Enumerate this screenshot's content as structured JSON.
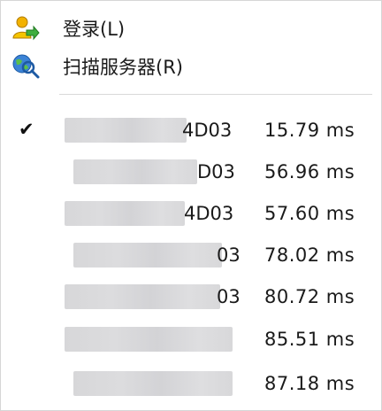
{
  "menu": {
    "items": [
      {
        "label": "登录(L)",
        "icon": "login-user-icon"
      },
      {
        "label": "扫描服务器(R)",
        "icon": "scan-globe-icon"
      }
    ],
    "servers": [
      {
        "checked": true,
        "check": "✔",
        "name_visible": "4D03",
        "ping": "15.79 ms"
      },
      {
        "checked": false,
        "check": "",
        "name_visible": "D03",
        "ping": "56.96 ms"
      },
      {
        "checked": false,
        "check": "",
        "name_visible": "4D03",
        "ping": "57.60 ms"
      },
      {
        "checked": false,
        "check": "",
        "name_visible": "03",
        "ping": "78.02 ms"
      },
      {
        "checked": false,
        "check": "",
        "name_visible": "03",
        "ping": "80.72 ms"
      },
      {
        "checked": false,
        "check": "",
        "name_visible": "",
        "ping": "85.51 ms"
      },
      {
        "checked": false,
        "check": "",
        "name_visible": "",
        "ping": "87.18 ms"
      }
    ]
  }
}
